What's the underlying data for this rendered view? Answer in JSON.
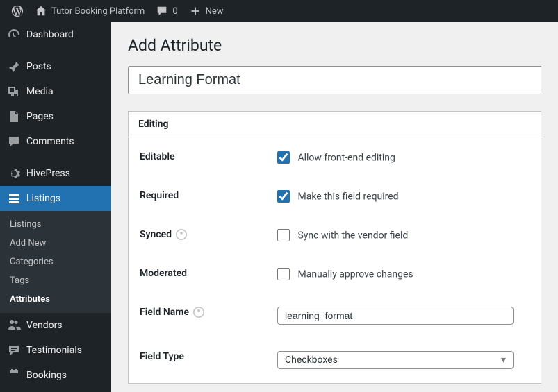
{
  "topbar": {
    "site_name": "Tutor Booking Platform",
    "comments_count": "0",
    "new_label": "New"
  },
  "sidebar": {
    "dashboard": "Dashboard",
    "posts": "Posts",
    "media": "Media",
    "pages": "Pages",
    "comments": "Comments",
    "hivepress": "HivePress",
    "listings": "Listings",
    "sub": {
      "listings": "Listings",
      "add_new": "Add New",
      "categories": "Categories",
      "tags": "Tags",
      "attributes": "Attributes"
    },
    "vendors": "Vendors",
    "testimonials": "Testimonials",
    "bookings": "Bookings"
  },
  "page": {
    "title": "Add Attribute",
    "attribute_title_value": "Learning Format"
  },
  "form": {
    "section_title": "Editing",
    "editable_label": "Editable",
    "editable_chk": "Allow front-end editing",
    "required_label": "Required",
    "required_chk": "Make this field required",
    "synced_label": "Synced",
    "synced_chk": "Sync with the vendor field",
    "moderated_label": "Moderated",
    "moderated_chk": "Manually approve changes",
    "field_name_label": "Field Name",
    "field_name_value": "learning_format",
    "field_type_label": "Field Type",
    "field_type_value": "Checkboxes"
  }
}
